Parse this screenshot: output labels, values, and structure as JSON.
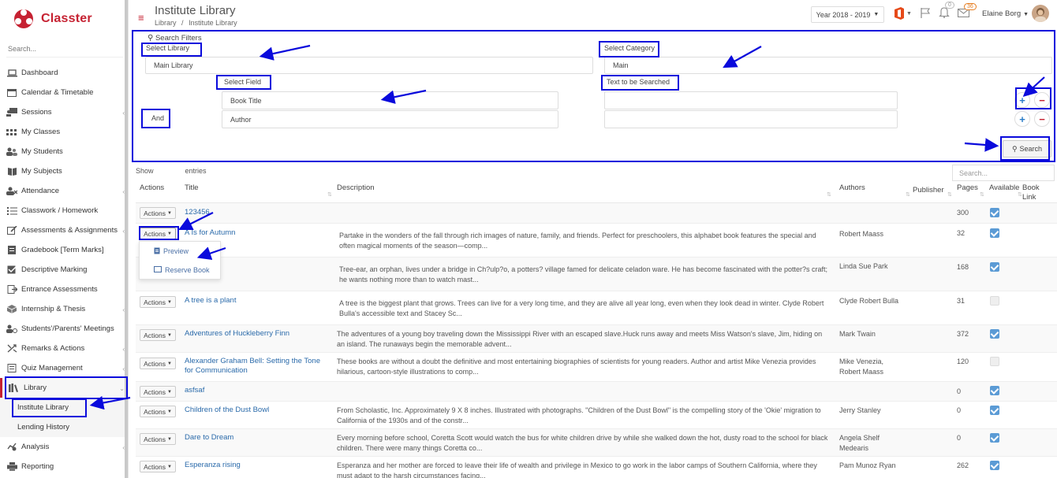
{
  "app": {
    "name": "Classter"
  },
  "sidebar": {
    "search_placeholder": "Search...",
    "items": [
      {
        "label": "Dashboard",
        "icon": "laptop-icon"
      },
      {
        "label": "Calendar & Timetable",
        "icon": "calendar-icon"
      },
      {
        "label": "Sessions",
        "icon": "presentation-icon"
      },
      {
        "label": "My Classes",
        "icon": "classes-icon"
      },
      {
        "label": "My Students",
        "icon": "students-icon"
      },
      {
        "label": "My Subjects",
        "icon": "book-icon"
      },
      {
        "label": "Attendance",
        "icon": "attendance-icon"
      },
      {
        "label": "Classwork / Homework",
        "icon": "list-icon"
      },
      {
        "label": "Assessments & Assignments",
        "icon": "edit-icon"
      },
      {
        "label": "Gradebook [Term Marks]",
        "icon": "gradebook-icon"
      },
      {
        "label": "Descriptive Marking",
        "icon": "check-icon"
      },
      {
        "label": "Entrance Assessments",
        "icon": "entrance-icon"
      },
      {
        "label": "Internship & Thesis",
        "icon": "cube-icon"
      },
      {
        "label": "Students'/Parents' Meetings",
        "icon": "meeting-icon"
      },
      {
        "label": "Remarks & Actions",
        "icon": "remarks-icon"
      },
      {
        "label": "Quiz Management",
        "icon": "quiz-icon"
      },
      {
        "label": "Library",
        "icon": "library-icon"
      },
      {
        "label": "Institute Library"
      },
      {
        "label": "Lending History"
      },
      {
        "label": "Analysis",
        "icon": "analysis-icon"
      },
      {
        "label": "Reporting",
        "icon": "printer-icon"
      }
    ]
  },
  "header": {
    "title": "Institute Library",
    "breadcrumb": [
      "Library",
      "/",
      "Institute Library"
    ],
    "year": "Year 2018 - 2019",
    "flag_count": "0",
    "mail_count": "36",
    "user": "Elaine Borg"
  },
  "filters": {
    "title": "Search Filters",
    "select_library_label": "Select Library",
    "select_library_value": "Main Library",
    "select_category_label": "Select Category",
    "select_category_value": "Main",
    "select_field_label": "Select Field",
    "text_searched_label": "Text to be Searched",
    "conjunction": "And",
    "field1": "Book Title",
    "field2": "Author",
    "search_button": "Search"
  },
  "table": {
    "show_label": "Show",
    "entries_label": "entries",
    "search_placeholder": "Search...",
    "columns": [
      "Actions",
      "Title",
      "Description",
      "Authors",
      "Publisher",
      "Pages",
      "Available",
      "Book Link"
    ],
    "action_label": "Actions",
    "rows": [
      {
        "title": "123456",
        "description": "",
        "authors": "",
        "pages": "300",
        "available": true
      },
      {
        "title": "A Is for Autumn",
        "description": "Partake in the wonders of the fall through rich images of nature, family, and friends. Perfect for preschoolers, this alphabet book features the special and often magical moments of the season—comp...",
        "authors": "Robert Maass",
        "pages": "32",
        "available": true
      },
      {
        "title": "",
        "description": "Tree-ear, an orphan, lives under a bridge in Ch?ulp?o, a potters? village famed for delicate celadon ware. He has become fascinated with the potter?s craft; he wants nothing more than to watch mast...",
        "authors": "Linda Sue Park",
        "pages": "168",
        "available": true
      },
      {
        "title": "A tree is a plant",
        "description": "A tree is the biggest plant that grows. Trees can live for a very long time, and they are alive all year long, even when they look dead in winter. Clyde Robert Bulla's accessible text and Stacey Sc...",
        "authors": "Clyde Robert Bulla",
        "pages": "31",
        "available": false
      },
      {
        "title": "Adventures of Huckleberry Finn",
        "description": "The adventures of a young boy traveling down the Mississippi River with an escaped slave.Huck runs away and meets Miss Watson's slave, Jim, hiding on an island. The runaways begin the memorable advent...",
        "authors": "Mark Twain",
        "pages": "372",
        "available": true
      },
      {
        "title": "Alexander Graham Bell: Setting the Tone for Communication",
        "description": "These books are without a doubt the definitive and most entertaining biographies of scientists for young readers. Author and artist Mike Venezia provides hilarious, cartoon-style illustrations to comp...",
        "authors": "Mike Venezia, Robert Maass",
        "pages": "120",
        "available": false
      },
      {
        "title": "asfsaf",
        "description": "",
        "authors": "",
        "pages": "0",
        "available": true
      },
      {
        "title": "Children of the Dust Bowl",
        "description": "From Scholastic, Inc. Approximately 9 X 8 inches. Illustrated with photographs. \"Children of the Dust Bowl\" is the compelling story of the 'Okie' migration to California of the 1930s and of the constr...",
        "authors": "Jerry Stanley",
        "pages": "0",
        "available": true
      },
      {
        "title": "Dare to Dream",
        "description": "Every morning before school, Coretta Scott would watch the bus for white children drive by while she walked down the hot, dusty road to the school for black children. There were many things Coretta co...",
        "authors": "Angela Shelf Medearis",
        "pages": "0",
        "available": true
      },
      {
        "title": "Esperanza rising",
        "description": "Esperanza and her mother are forced to leave their life of wealth and privilege in Mexico to go work in the labor camps of Southern California, where they must adapt to the harsh circumstances facing...",
        "authors": "Pam Munoz Ryan",
        "pages": "262",
        "available": true
      }
    ],
    "dropdown": [
      {
        "label": "Preview",
        "icon": "preview-icon"
      },
      {
        "label": "Reserve Book",
        "icon": "reserve-icon"
      }
    ]
  },
  "colors": {
    "brand": "#c62232",
    "link": "#2a6aaa",
    "highlight": "#0a0adc",
    "check": "#5b9bd5"
  }
}
